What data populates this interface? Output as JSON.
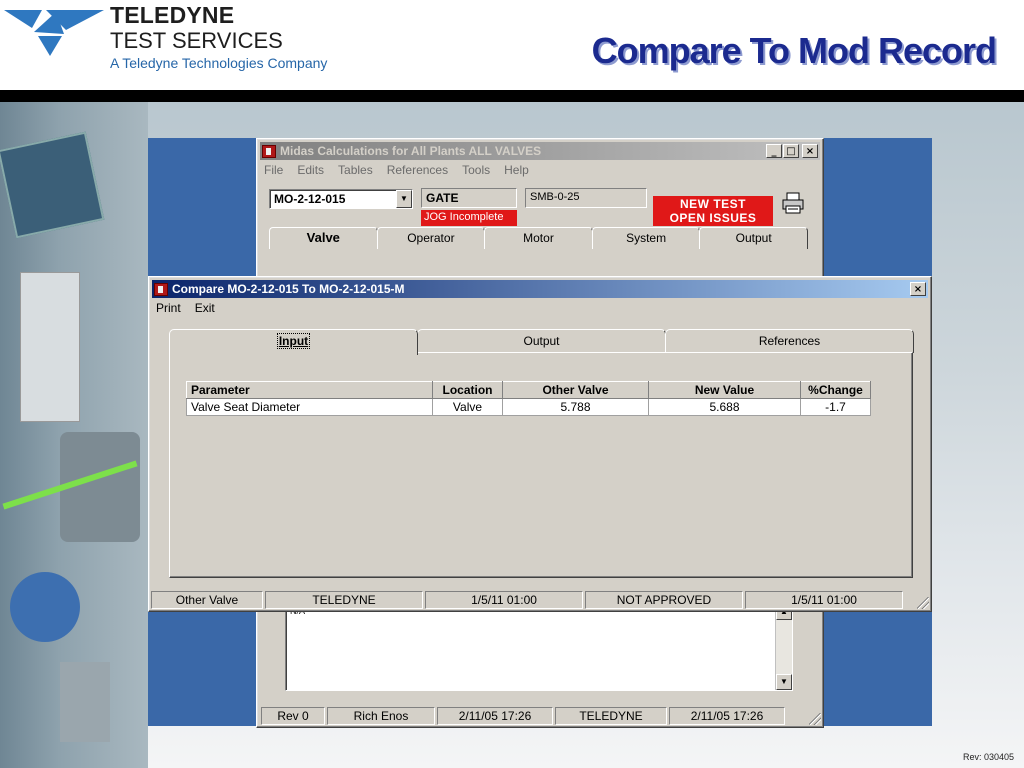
{
  "slide": {
    "brand_line1": "TELEDYNE",
    "brand_line2": "TEST SERVICES",
    "brand_line3": "A Teledyne Technologies Company",
    "title": "Compare To Mod Record",
    "rev": "Rev: 030405"
  },
  "colors": {
    "title": "#1b2a8f",
    "brand_blue": "#2666a8",
    "alert_red": "#e01818",
    "active_titlebar": "#0a246a",
    "frame_blue": "#3a68a8"
  },
  "midas_window": {
    "title": "Midas Calculations for All Plants ALL VALVES",
    "menu": [
      "File",
      "Edits",
      "Tables",
      "References",
      "Tools",
      "Help"
    ],
    "mo_select": "MO-2-12-015",
    "type_box": "GATE",
    "jog_label": "JOG Incomplete",
    "smb_box": "SMB-0-25",
    "new_test_line1": "NEW TEST",
    "new_test_line2": "OPEN ISSUES",
    "tabs": [
      "Valve",
      "Operator",
      "Motor",
      "System",
      "Output"
    ],
    "selected_tab": "Valve",
    "lower_text": "N/A",
    "status": [
      "Rev 0",
      "Rich Enos",
      "2/11/05 17:26",
      "TELEDYNE",
      "2/11/05 17:26"
    ]
  },
  "compare_window": {
    "title": "Compare MO-2-12-015 To MO-2-12-015-M",
    "menu": [
      "Print",
      "Exit"
    ],
    "tabs": [
      "Input",
      "Output",
      "References"
    ],
    "selected_tab": "Input",
    "table": {
      "headers": [
        "Parameter",
        "Location",
        "Other Valve",
        "New Value",
        "%Change"
      ],
      "rows": [
        [
          "Valve Seat Diameter",
          "Valve",
          "5.788",
          "5.688",
          "-1.7"
        ]
      ]
    },
    "status": [
      "Other Valve",
      "TELEDYNE",
      "1/5/11 01:00",
      "NOT APPROVED",
      "1/5/11 01:00"
    ]
  },
  "icons": {
    "logo": "teledyne-logo-icon",
    "printer": "printer-icon",
    "app": "app-icon"
  }
}
